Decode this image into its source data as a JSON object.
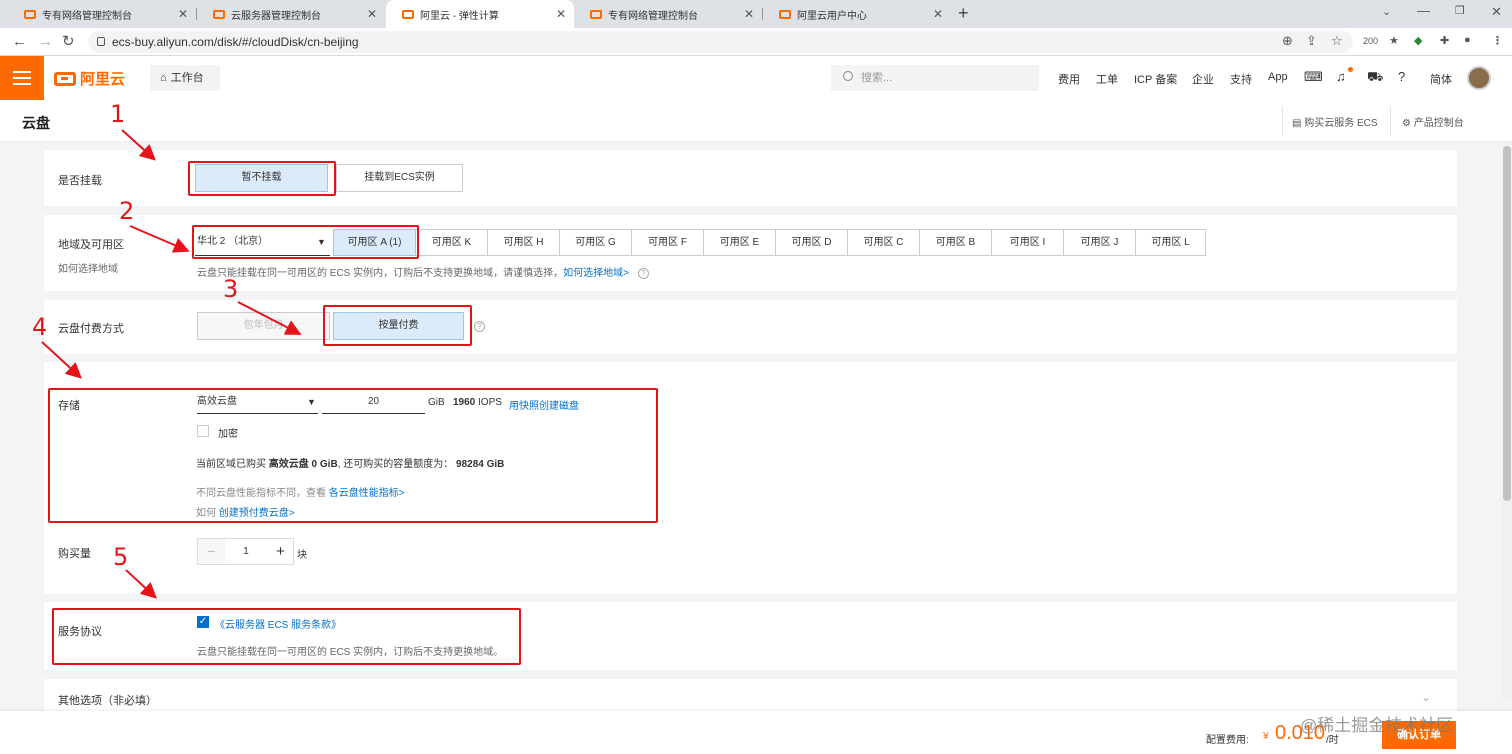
{
  "browser": {
    "tabs": [
      {
        "title": "专有网络管理控制台"
      },
      {
        "title": "云服务器管理控制台"
      },
      {
        "title": "阿里云 - 弹性计算"
      },
      {
        "title": "专有网络管理控制台"
      },
      {
        "title": "阿里云用户中心"
      }
    ],
    "new_tab": "+",
    "url": "ecs-buy.aliyun.com/disk/#/cloudDisk/cn-beijing",
    "zoom_badge": "200"
  },
  "console": {
    "logo_text": "阿里云",
    "workbench": "工作台",
    "search_placeholder": "搜索...",
    "links": [
      "费用",
      "工单",
      "ICP 备案",
      "企业",
      "支持",
      "App"
    ],
    "lang": "简体"
  },
  "page": {
    "title": "云盘",
    "buy_ecs": "购买云服务 ECS",
    "product_console": "产品控制台"
  },
  "form": {
    "mount": {
      "label": "是否挂载",
      "options": [
        "暂不挂载",
        "挂载到ECS实例"
      ],
      "selected": "暂不挂载"
    },
    "region": {
      "label": "地域及可用区",
      "help": "如何选择地域",
      "region_value": "华北 2 （北京）",
      "zones": [
        "可用区 A (1)",
        "可用区 K",
        "可用区 H",
        "可用区 G",
        "可用区 F",
        "可用区 E",
        "可用区 D",
        "可用区 C",
        "可用区 B",
        "可用区 I",
        "可用区 J",
        "可用区 L"
      ],
      "note": "云盘只能挂载在同一可用区的 ECS 实例内，订购后不支持更换地域，请谨慎选择，",
      "note_link": "如何选择地域>"
    },
    "billing": {
      "label": "云盘付费方式",
      "options": [
        "包年包月",
        "按量付费"
      ],
      "selected": "按量付费"
    },
    "storage": {
      "label": "存储",
      "disk_type": "高效云盘",
      "size": "20",
      "unit": "GiB",
      "iops_value": "1960",
      "iops_label": "IOPS",
      "snapshot_link": "用快照创建磁盘",
      "encrypt": "加密",
      "quota_prefix": "当前区域已购买",
      "quota_used": "高效云盘 0 GiB",
      "quota_middle": ", 还可购买的容量额度为：",
      "quota_left": "98284 GiB",
      "perf_note": "不同云盘性能指标不同，查看",
      "perf_link": "各云盘性能指标>",
      "prepaid_prefix": "如何",
      "prepaid_link": "创建预付费云盘>"
    },
    "quantity": {
      "label": "购买量",
      "value": "1",
      "unit": "块",
      "minus": "−",
      "plus": "+"
    },
    "agreement": {
      "label": "服务协议",
      "checked": true,
      "terms": "《云服务器 ECS 服务条款》",
      "note": "云盘只能挂载在同一可用区的 ECS 实例内，订购后不支持更换地域。"
    },
    "other": {
      "label": "其他选项（非必填）"
    }
  },
  "footer": {
    "fee_label": "配置费用:",
    "currency": "¥",
    "price": "0.010",
    "per": "/时",
    "confirm": "确认订单",
    "watermark": "@稀土掘金技术社区"
  },
  "annotations": [
    "1",
    "2",
    "3",
    "4",
    "5"
  ],
  "colors": {
    "brand": "#ff6a00",
    "link": "#0070cc",
    "annotation": "#e5141a",
    "selected_bg": "#dcebf9"
  }
}
